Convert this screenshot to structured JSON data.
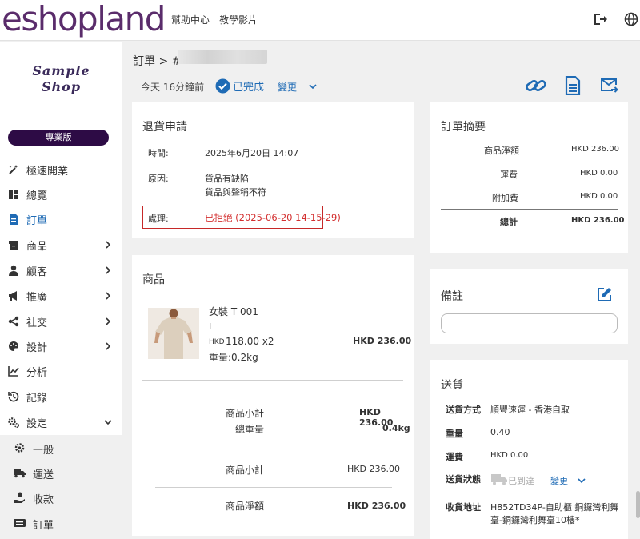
{
  "topbar": {
    "logo": "eshopland",
    "links": [
      "幫助中心",
      "教學影片"
    ]
  },
  "sidebar": {
    "shop_name_line1": "Sample",
    "shop_name_line2": "Shop",
    "plan_badge": "專業版",
    "items": [
      {
        "label": "極速開業",
        "icon": "magic-wand-icon"
      },
      {
        "label": "總覽",
        "icon": "dashboard-icon"
      },
      {
        "label": "訂單",
        "icon": "order-file-icon"
      },
      {
        "label": "商品",
        "icon": "box-icon"
      },
      {
        "label": "顧客",
        "icon": "user-icon"
      },
      {
        "label": "推廣",
        "icon": "megaphone-icon"
      },
      {
        "label": "社交",
        "icon": "share-icon"
      },
      {
        "label": "設計",
        "icon": "palette-icon"
      },
      {
        "label": "分析",
        "icon": "chart-icon"
      },
      {
        "label": "記錄",
        "icon": "history-icon"
      },
      {
        "label": "設定",
        "icon": "gears-icon"
      }
    ],
    "sub_items": [
      {
        "label": "一般",
        "icon": "gear-icon"
      },
      {
        "label": "運送",
        "icon": "truck-icon"
      },
      {
        "label": "收款",
        "icon": "payment-hand-icon"
      },
      {
        "label": "訂單",
        "icon": "order-ticket-icon"
      }
    ]
  },
  "order_header": {
    "breadcrumb": "訂單 > #",
    "time_ago": "今天 16分鐘前",
    "status": "已完成",
    "change": "變更"
  },
  "return_request": {
    "title": "退貨申請",
    "time_label": "時間:",
    "time_value": "2025年6月20日 14:07",
    "reason_label": "原因:",
    "reason_line1": "貨品有缺陷",
    "reason_line2": "貨品與聲稱不符",
    "process_label": "處理:",
    "process_value": "已拒絕 (2025-06-20 14-15-29)"
  },
  "products": {
    "title": "商品",
    "item_name": "女裝 T 001",
    "item_variant": "L",
    "item_currency": "HKD",
    "item_price": "118.00 x2",
    "item_weight": "重量:0.2kg",
    "item_total": "HKD 236.00",
    "subtotal_label": "商品小計",
    "subtotal_value": "HKD 236.00",
    "weight_label": "總重量",
    "weight_value": "0.4kg",
    "subtotal2_label": "商品小計",
    "subtotal2_value": "HKD 236.00",
    "net_label": "商品淨額",
    "net_value": "HKD 236.00"
  },
  "summary": {
    "title": "訂單摘要",
    "rows": [
      {
        "label": "商品淨額",
        "value": "HKD 236.00"
      },
      {
        "label": "運費",
        "value": "HKD 0.00"
      },
      {
        "label": "附加費",
        "value": "HKD 0.00"
      }
    ],
    "total_label": "總計",
    "total_value": "HKD 236.00"
  },
  "remarks": {
    "title": "備註",
    "value": ""
  },
  "shipping": {
    "title": "送貨",
    "method_label": "送貨方式",
    "method_value": "順豐速運 - 香港自取",
    "weight_label": "重量",
    "weight_value": "0.40",
    "fee_label": "運費",
    "fee_value": "HKD 0.00",
    "status_label": "送貨狀態",
    "status_value": "已到達",
    "change": "變更",
    "address_label": "收貨地址",
    "address_line1": "H852TD34P-自助櫃 銅鑼灣利舞",
    "address_line2": "臺-銅鑼灣利舞臺10樓*"
  },
  "colors": {
    "brand": "#5a2c6b",
    "link": "#1f6bb5",
    "rejected": "#d32f2f",
    "badge": "#2d0b45"
  }
}
